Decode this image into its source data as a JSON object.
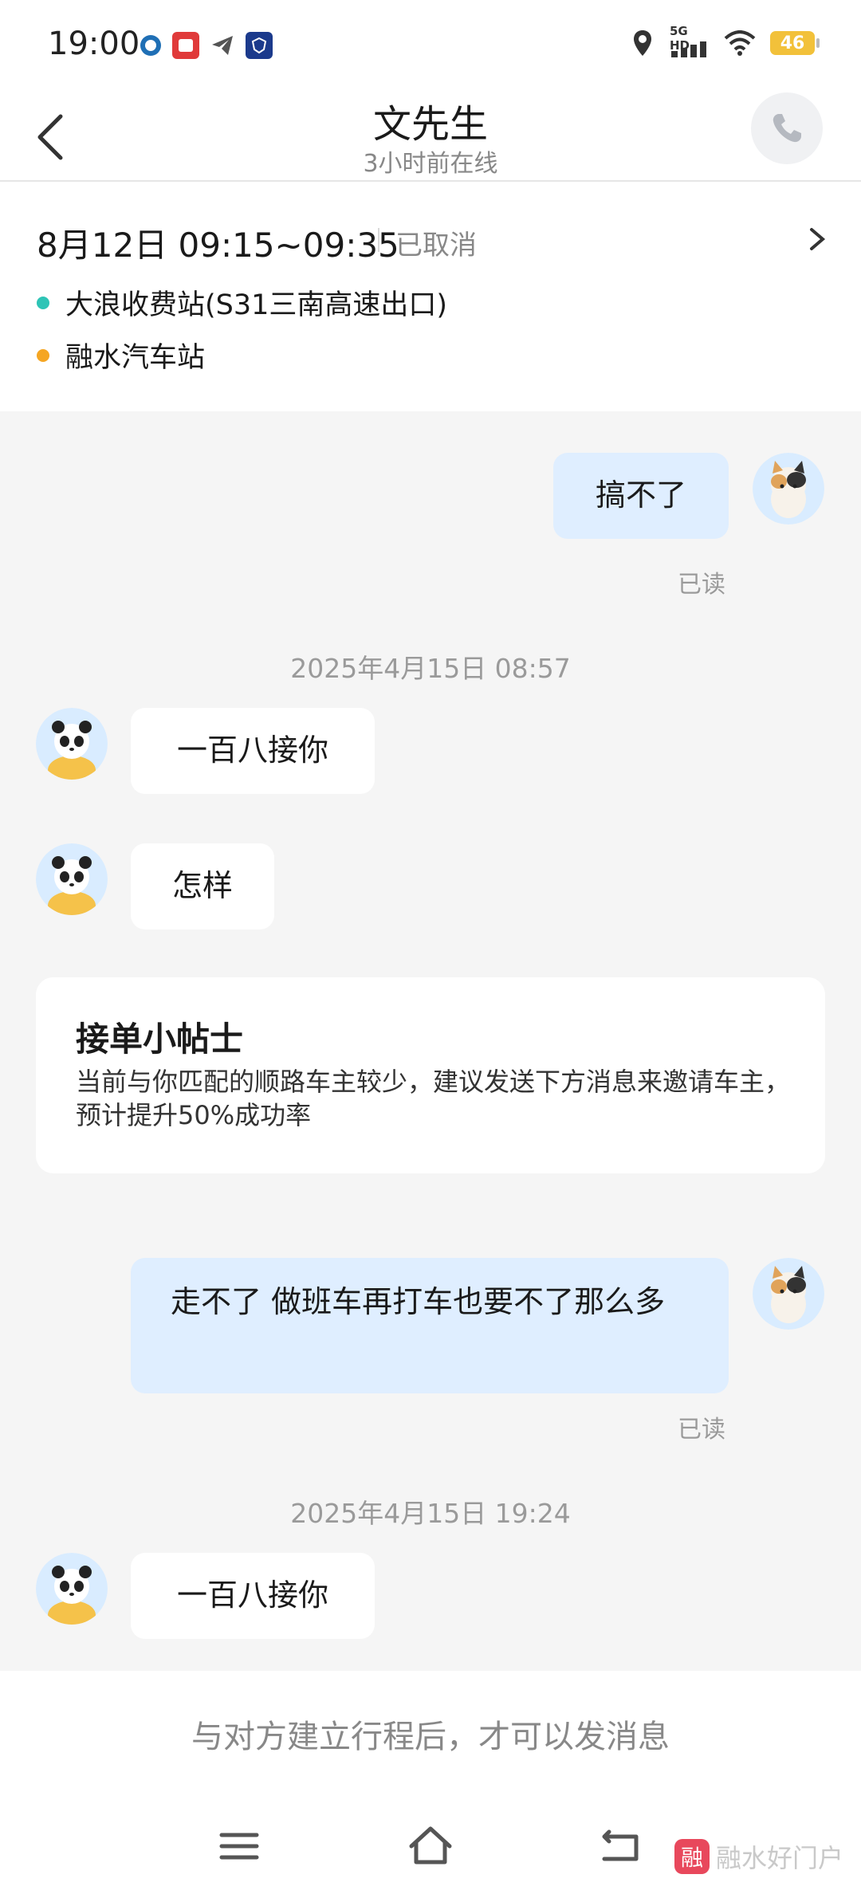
{
  "status_bar": {
    "time": "19:00",
    "network_label": "5G HD",
    "battery": "46",
    "icons": [
      "location-pin-icon",
      "signal-icon",
      "wifi-icon",
      "battery-icon"
    ],
    "app_icons": [
      "shield-app-icon",
      "news-app-icon",
      "telegram-icon",
      "vpn-app-icon"
    ]
  },
  "header": {
    "title": "文先生",
    "subtitle": "3小时前在线"
  },
  "trip": {
    "time_range": "8月12日 09:15~09:35",
    "status": "已取消",
    "start": "大浪收费站(S31三南高速出口)",
    "end": "融水汽车站",
    "start_dot_color": "#2ec4b6",
    "end_dot_color": "#f5a623"
  },
  "messages": {
    "m1": {
      "text": "搞不了",
      "read": "已读"
    },
    "ts1": "2025年4月15日 08:57",
    "m2": {
      "text": "一百八接你"
    },
    "m3": {
      "text": "怎样"
    },
    "tips": {
      "title": "接单小帖士",
      "body": "当前与你匹配的顺路车主较少，建议发送下方消息来邀请车主，预计提升50%成功率"
    },
    "m4": {
      "text": "走不了 做班车再打车也要不了那么多",
      "read": "已读"
    },
    "ts2": "2025年4月15日 19:24",
    "m5": {
      "text": "一百八接你"
    }
  },
  "footer": {
    "note": "与对方建立行程后，才可以发消息"
  },
  "watermark": {
    "logo_char": "融",
    "text": "融水好门户"
  },
  "colors": {
    "my_bubble": "#dfeeff",
    "their_bubble": "#ffffff",
    "background": "#f5f5f5"
  }
}
